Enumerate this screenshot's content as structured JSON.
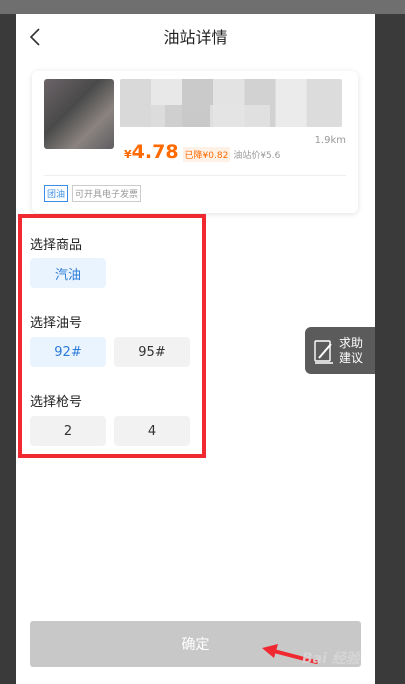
{
  "header": {
    "title": "油站详情"
  },
  "station": {
    "distance": "1.9km",
    "currency": "¥",
    "price": "4.78",
    "price_drop": "已降¥0.82",
    "station_price": "油站价¥5.6",
    "tags": [
      "团油",
      "可开具电子发票"
    ]
  },
  "product": {
    "label": "选择商品",
    "options": [
      "汽油"
    ],
    "selected": "汽油"
  },
  "oil": {
    "label": "选择油号",
    "options": [
      "92#",
      "95#"
    ],
    "selected": "92#"
  },
  "gun": {
    "label": "选择枪号",
    "options": [
      "2",
      "4"
    ],
    "selected": ""
  },
  "help": {
    "line1": "求助",
    "line2": "建议"
  },
  "confirm_label": "确定",
  "watermark": "Bai 经验",
  "colors": {
    "accent": "#2b7bd9",
    "price": "#ff6a00",
    "highlight": "#f0282f"
  }
}
